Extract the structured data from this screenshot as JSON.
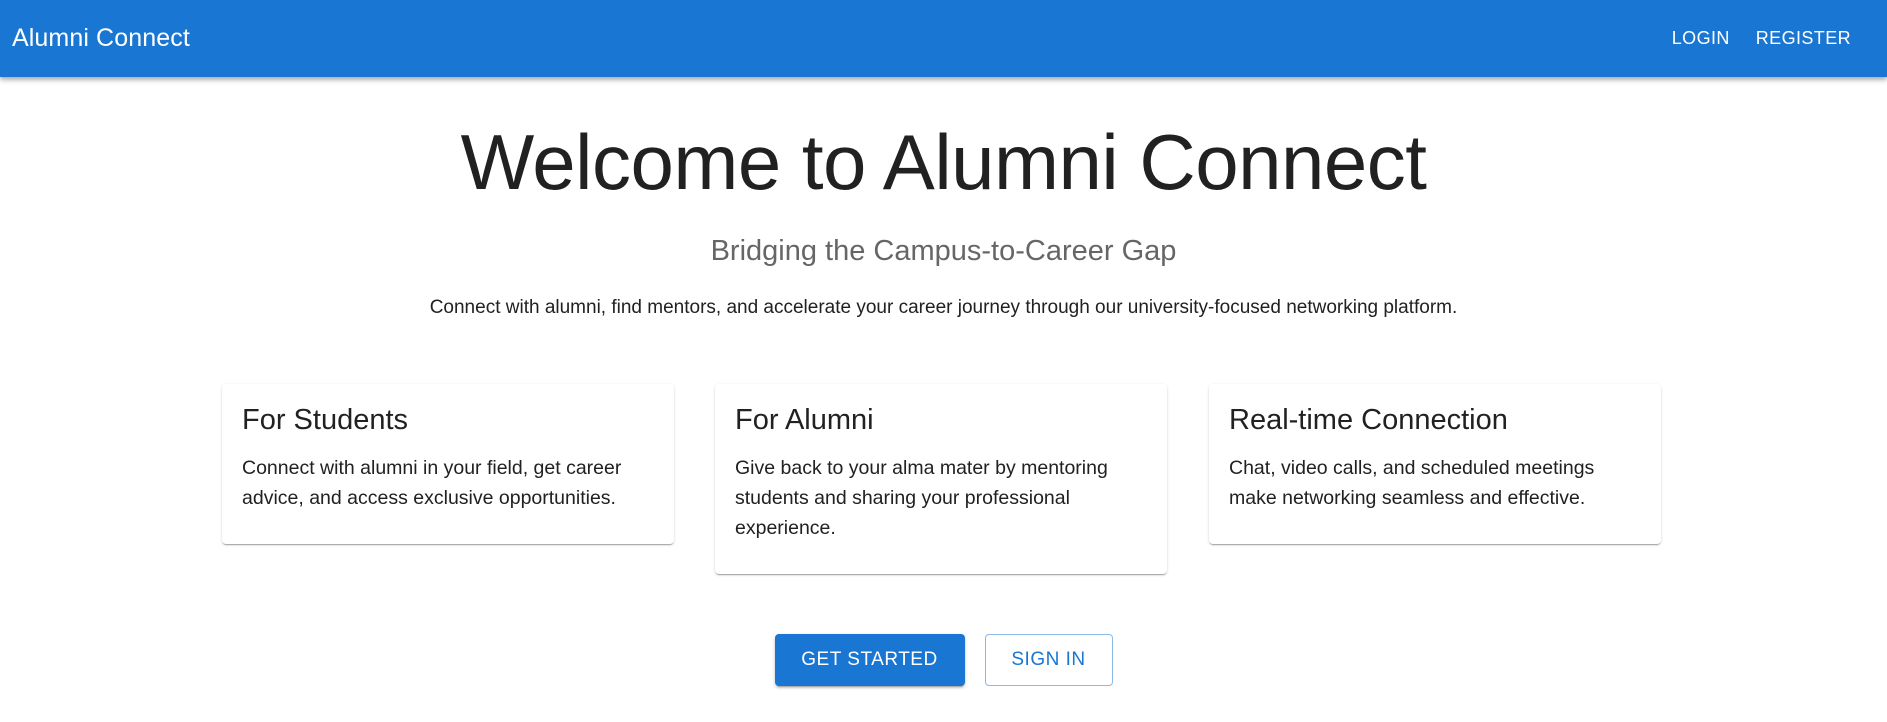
{
  "header": {
    "brand": "Alumni Connect",
    "nav": [
      "LOGIN",
      "REGISTER"
    ]
  },
  "hero": {
    "title": "Welcome to Alumni Connect",
    "subtitle": "Bridging the Campus-to-Career Gap",
    "description": "Connect with alumni, find mentors, and accelerate your career journey through our university-focused networking platform."
  },
  "features": [
    {
      "title": "For Students",
      "text": "Connect with alumni in your field, get career advice, and access exclusive opportunities."
    },
    {
      "title": "For Alumni",
      "text": "Give back to your alma mater by mentoring students and sharing your professional experience."
    },
    {
      "title": "Real-time Connection",
      "text": "Chat, video calls, and scheduled meetings make networking seamless and effective."
    }
  ],
  "cta": {
    "primary": "GET STARTED",
    "secondary": "SIGN IN"
  },
  "colors": {
    "primary": "#1976d2",
    "subtitle": "#666666",
    "text": "#212121"
  }
}
